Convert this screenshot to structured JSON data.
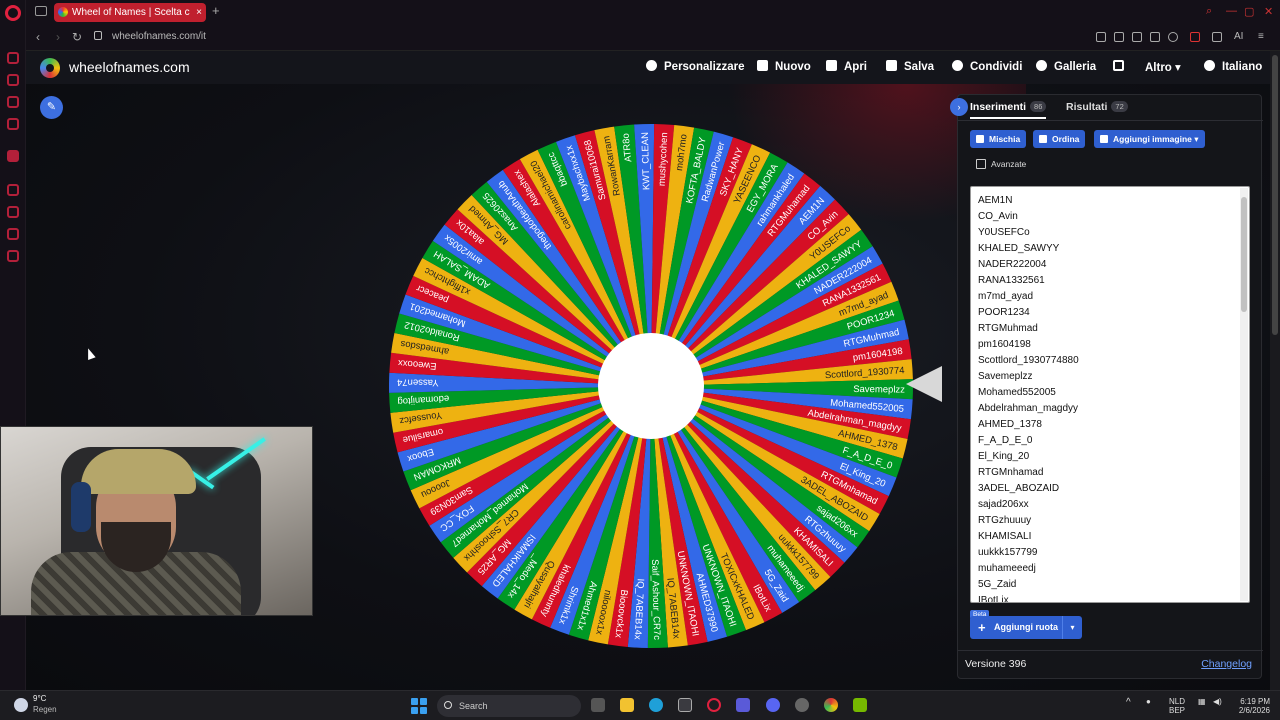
{
  "browser": {
    "tab_title": "Wheel of Names | Scelta c",
    "new_tab": "+",
    "url": "wheelofnames.com/it",
    "ai_label": "AI"
  },
  "site": {
    "brand": "wheelofnames.com",
    "menu": [
      "Personalizzare",
      "Nuovo",
      "Apri",
      "Salva",
      "Condividi",
      "Galleria",
      "Altro",
      "Italiano"
    ]
  },
  "panel": {
    "tab_entries": "Inserimenti",
    "tab_entries_count": "86",
    "tab_results": "Risultati",
    "tab_results_count": "72",
    "btn_shuffle": "Mischia",
    "btn_sort": "Ordina",
    "btn_add_image": "Aggiungi immagine",
    "advanced": "Avanzate",
    "entries": [
      "AEM1N",
      "CO_Avin",
      "Y0USEFCo",
      "KHALED_SAWYY",
      "NADER222004",
      "RANA1332561",
      "m7md_ayad",
      "POOR1234",
      "RTGMuhmad",
      "pm1604198",
      "Scottlord_1930774880",
      "Savemeplzz",
      "Mohamed552005",
      "Abdelrahman_magdyy",
      "AHMED_1378",
      "F_A_D_E_0",
      "El_King_20",
      "RTGMnhamad",
      "3ADEL_ABOZAID",
      "sajad206xx",
      "RTGzhuuuy",
      "KHAMISALI",
      "uukkk157799",
      "muhameeedj",
      "5G_Zaid",
      "IBotLix"
    ],
    "beta": "Beta",
    "add_wheel": "Aggiungi ruota",
    "version": "Versione 396",
    "changelog": "Changelog"
  },
  "wheel": {
    "colors": [
      "#3369e8",
      "#d50f25",
      "#eeb211",
      "#009925"
    ],
    "labels": [
      "AEM1N",
      "CO_Avin",
      "Y0USEFCo",
      "KHALED_SAWYY",
      "NADER222004",
      "RANA1332561",
      "m7md_ayad",
      "POOR1234",
      "RTGMuhmad",
      "pm1604198",
      "Scottlord_1930774",
      "Savemeplzz",
      "Mohamed552005",
      "Abdelrahman_magdyy",
      "AHMED_1378",
      "F_A_D_E_0",
      "El_King_20",
      "RTGMnhamad",
      "3ADEL_ABOZAID",
      "sajad206xx",
      "RTGzhuuuy",
      "KHAMISALI",
      "uukkk157799",
      "muhameeedj",
      "5G_Zaid",
      "IBotLix",
      "TOXICxKHALED",
      "UNKNOWN_ITAOHI",
      "AHMED37990",
      "UNKNOWN_ITAOHI",
      "IQ_7ABEB14x",
      "Saif_Ashour_CR7c",
      "IQ_7ABEB14x",
      "Biooovck1x",
      "niloooox1x",
      "Ahmed1x1x",
      "Shrimk1x",
      "khaledhunnty",
      "Qusayalhajri",
      "_Medo_14x",
      "ISMAIKHALED",
      "MG_AR25",
      "CR7_Sshooshhx",
      "Mohamed_Mohamed7",
      "FOX_CC",
      "Sam30N39",
      "Joooou",
      "MRKOMAN",
      "Eboox",
      "omarsilue",
      "Youssefcz",
      "edomanijtog",
      "Yassen74",
      "Eweooxx",
      "ahmedsdos",
      "Ronaldo2012",
      "Mohamed201",
      "peacecr",
      "x1ffightchcc",
      "ADAM_SALAH",
      "amir2005x",
      "alaa10x",
      "MG_Ahmed",
      "Anasz0625",
      "thegodofdeathAnub",
      "Alalashex",
      "carolinamichael20",
      "bbaqttcc",
      "Maybachxx1x",
      "Samurai10068",
      "RowanKarram",
      "ATR8o",
      "KWT_CLEAN",
      "mushycohen",
      "moh7mo",
      "KOFTA_BALDY",
      "RadwanPower",
      "SKY_HANY",
      "YASEENCO",
      "EGY_MORA",
      "rahmankhaled",
      "RTGMuhamad"
    ]
  },
  "taskbar": {
    "temp": "9°C",
    "weather": "Regen",
    "search": "Search",
    "lang1": "NLD",
    "lang2": "BEP",
    "time": "6:19 PM",
    "date": "2/6/2026"
  }
}
